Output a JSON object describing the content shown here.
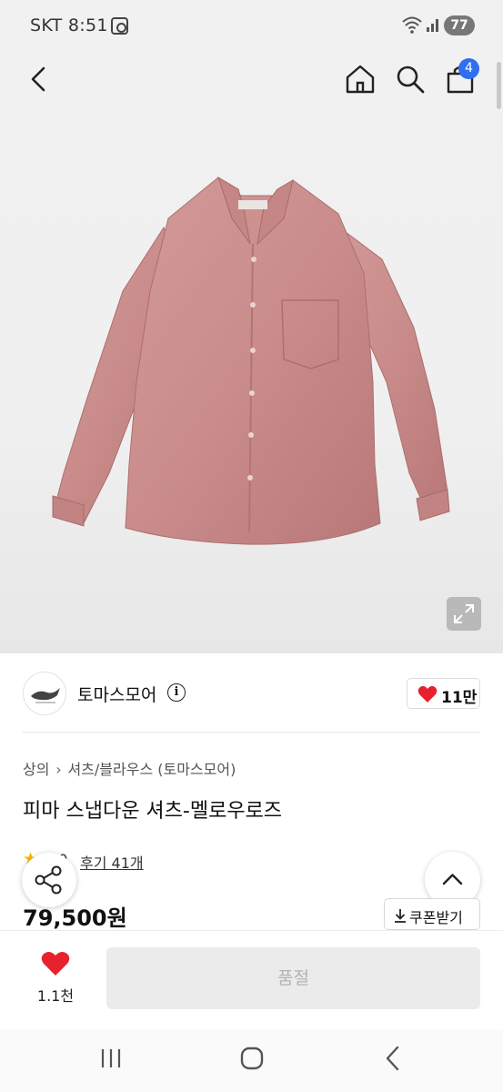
{
  "status_bar": {
    "time": "SKT 8:51",
    "battery": "77"
  },
  "header": {
    "cart_count": "4"
  },
  "brand": {
    "name": "토마스모어",
    "likes": "11만"
  },
  "breadcrumb": [
    "상의",
    "셔츠/블라우스 (토마스모어)"
  ],
  "product": {
    "title": "피마 스냅다운 셔츠-멜로우로즈",
    "rating": "5.0",
    "reviews": "후기 41개",
    "price": "79,500원",
    "coupon_label": "쿠폰받기"
  },
  "bottom_bar": {
    "wish_count": "1.1천",
    "action_label": "품절"
  },
  "colors": {
    "accent_blue": "#2f6ff0",
    "heart_red": "#e8212e",
    "star_yellow": "#f5b800",
    "shirt_rose": "#c98c8b"
  },
  "icons": [
    "back-arrow-icon",
    "home-icon",
    "search-icon",
    "cart-icon",
    "expand-icon",
    "info-icon",
    "heart-icon",
    "star-icon",
    "share-icon",
    "chevron-up-icon",
    "download-icon",
    "recent-apps-icon",
    "home-circle-icon",
    "nav-back-icon"
  ]
}
